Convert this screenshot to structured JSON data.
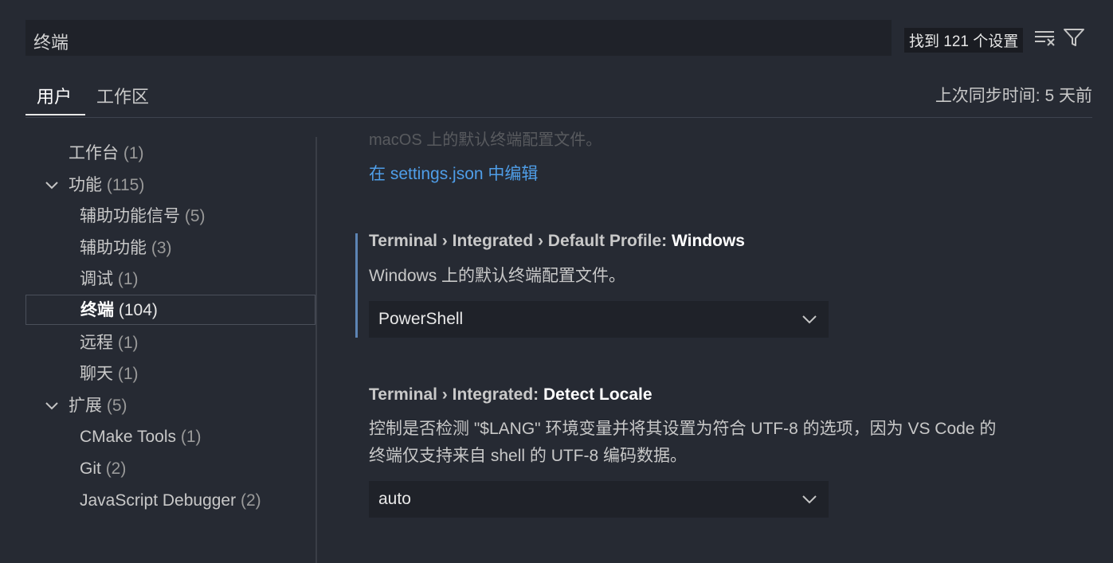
{
  "search": {
    "value": "终端",
    "result_count": "找到 121 个设置",
    "clear_icon": "clear-filter-icon",
    "filter_icon": "filter-icon"
  },
  "tabs": [
    {
      "label": "用户"
    },
    {
      "label": "工作区"
    }
  ],
  "sync_status": "上次同步时间: 5 天前",
  "toc": [
    {
      "label": "工作台",
      "count": "(1)"
    },
    {
      "label": "功能",
      "count": "(115)"
    },
    {
      "label": "辅助功能信号",
      "count": "(5)"
    },
    {
      "label": "辅助功能",
      "count": "(3)"
    },
    {
      "label": "调试",
      "count": "(1)"
    },
    {
      "label": "终端",
      "count": "(104)"
    },
    {
      "label": "远程",
      "count": "(1)"
    },
    {
      "label": "聊天",
      "count": "(1)"
    },
    {
      "label": "扩展",
      "count": "(5)"
    },
    {
      "label": "CMake Tools",
      "count": "(1)"
    },
    {
      "label": "Git",
      "count": "(2)"
    },
    {
      "label": "JavaScript Debugger",
      "count": "(2)"
    }
  ],
  "content": {
    "faded_text": "macOS 上的默认终端配置文件。",
    "edit_link": "在 settings.json 中编辑",
    "settings": [
      {
        "prefix": "Terminal › Integrated › Default Profile: ",
        "key": "Windows",
        "description": "Windows 上的默认终端配置文件。",
        "value": "PowerShell"
      },
      {
        "prefix": "Terminal › Integrated: ",
        "key": "Detect Locale",
        "description_line1": "控制是否检测 \"$LANG\" 环境变量并将其设置为符合 UTF-8 的选项，因为 VS Code 的",
        "description_line2": "终端仅支持来自 shell 的 UTF-8 编码数据。",
        "value": "auto"
      }
    ]
  },
  "colors": {
    "background": "#262a33",
    "input": "#1f2229",
    "link": "#4f9ee8",
    "focus_bar": "#5d85b5"
  }
}
